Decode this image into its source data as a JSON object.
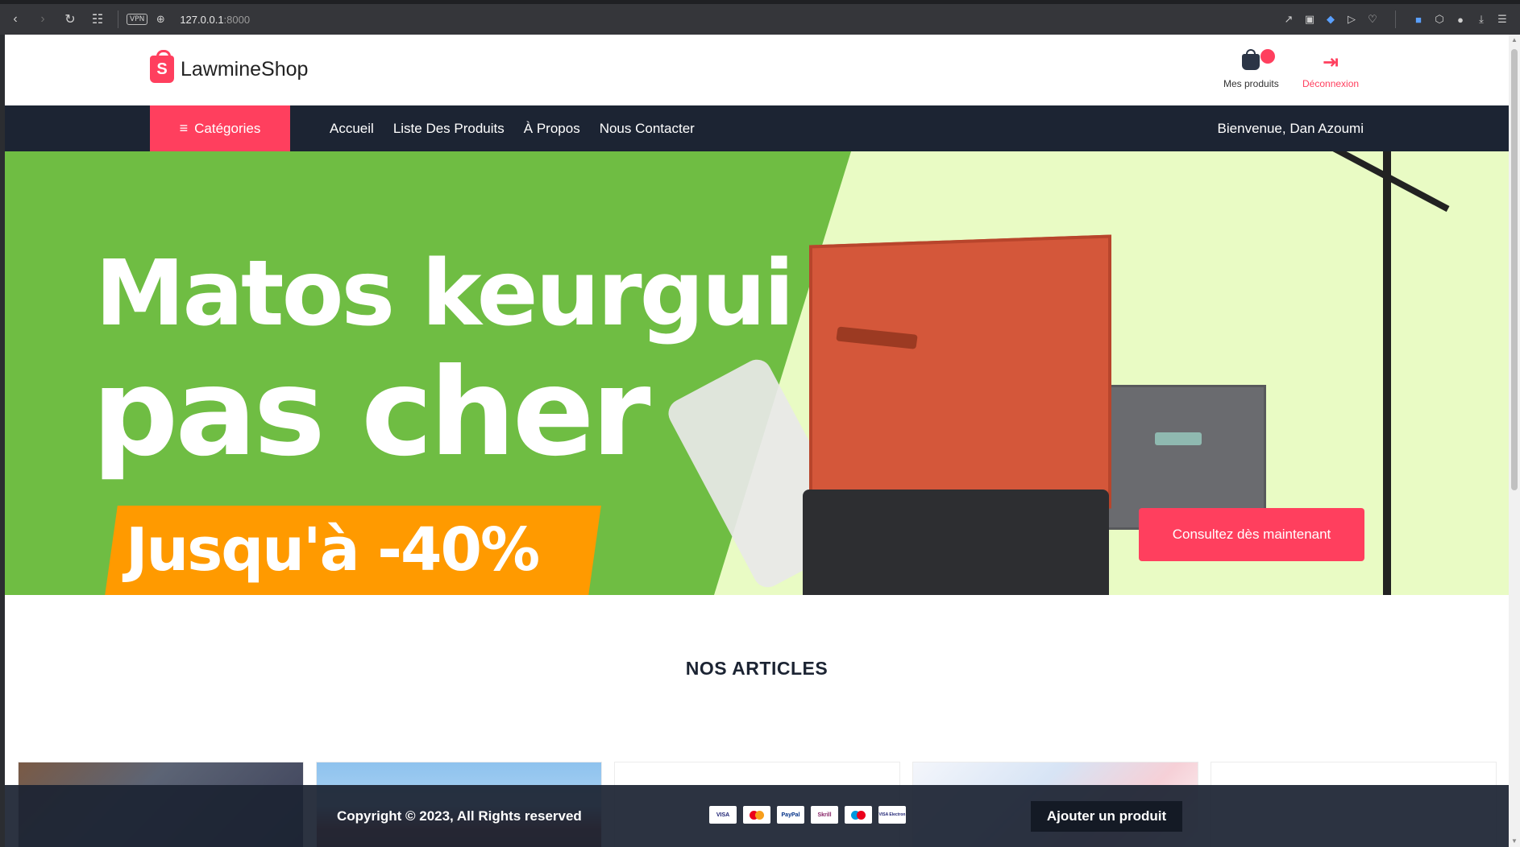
{
  "browser": {
    "url_host": "127.0.0.1",
    "url_port": ":8000",
    "vpn_label": "VPN"
  },
  "header": {
    "brand_initial": "S",
    "brand_name": "LawmineShop",
    "cart_label": "Mes produits",
    "logout_label": "Déconnexion"
  },
  "nav": {
    "categories_label": "Catégories",
    "links": [
      "Accueil",
      "Liste Des Produits",
      "À Propos",
      "Nous Contacter"
    ],
    "welcome": "Bienvenue, Dan Azoumi"
  },
  "hero": {
    "line1": "Matos keurgui",
    "line2": "pas cher",
    "line3": "Jusqu'à -40%",
    "cta": "Consultez dès maintenant"
  },
  "articles": {
    "title": "NOS ARTICLES"
  },
  "footer": {
    "copyright": "Copyright © 2023, All Rights reserved",
    "payments": [
      "VISA",
      "Mastercard",
      "PayPal",
      "Skrill",
      "Maestro",
      "VISA Electron"
    ],
    "add_button": "Ajouter un produit"
  },
  "colors": {
    "accent": "#ff3f5e",
    "navbar": "#1c2433",
    "hero_green": "#6fbd43",
    "hero_orange": "#ff9a00"
  }
}
